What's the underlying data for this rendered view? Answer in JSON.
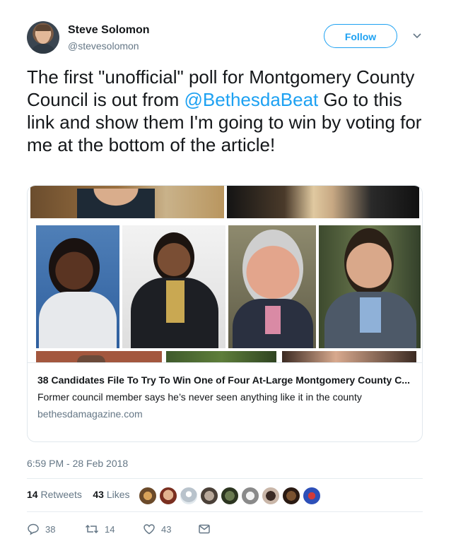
{
  "author": {
    "name": "Steve Solomon",
    "handle": "@stevesolomon"
  },
  "follow_label": "Follow",
  "tweet": {
    "text_before": "The first \"unofficial\" poll for Montgomery County Council is out from ",
    "mention": "@BethesdaBeat",
    "text_after": " Go to this link and show them I'm going to win by voting for me at the bottom of the article!"
  },
  "card": {
    "title": "38 Candidates File To Try To Win One of Four At-Large Montgomery County C...",
    "description": "Former council member says he’s never seen anything like it in the county",
    "domain": "bethesdamagazine.com"
  },
  "timestamp": "6:59 PM - 28 Feb 2018",
  "stats": {
    "retweets_count": "14",
    "retweets_label": "Retweets",
    "likes_count": "43",
    "likes_label": "Likes"
  },
  "actions": {
    "replies": "38",
    "retweets": "14",
    "likes": "43"
  },
  "colors": {
    "accent": "#1da1f2",
    "muted": "#657786"
  }
}
